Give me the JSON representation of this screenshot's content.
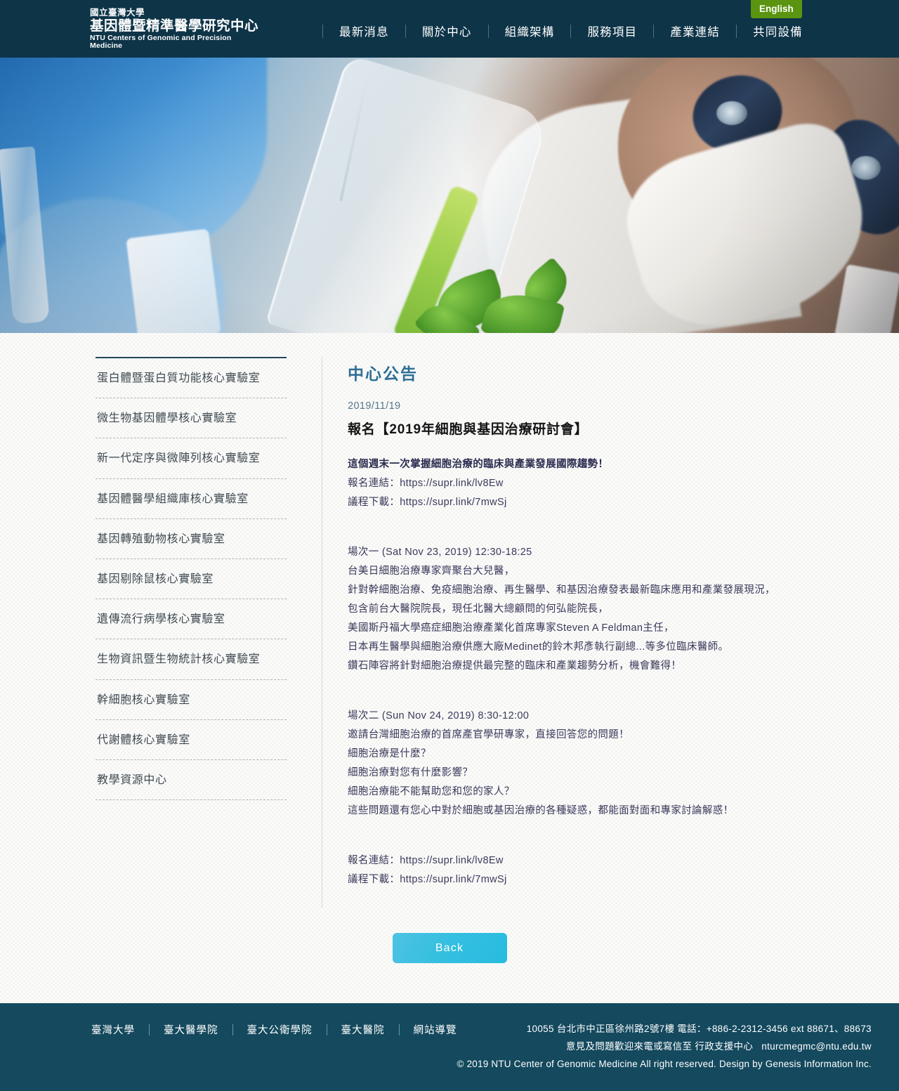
{
  "header": {
    "logo": {
      "line1": "國立臺灣大學",
      "line2": "基因體暨精準醫學研究中心",
      "line3": "NTU Centers of Genomic and Precision Medicine"
    },
    "nav": [
      {
        "label": "最新消息"
      },
      {
        "label": "關於中心"
      },
      {
        "label": "組織架構"
      },
      {
        "label": "服務項目"
      },
      {
        "label": "產業連結"
      },
      {
        "label": "共同設備"
      }
    ],
    "language_button": "English",
    "colors": {
      "header_bg": "#0e3448",
      "language_bg": "#5a9410"
    }
  },
  "sidebar": {
    "items": [
      {
        "label": "蛋白體暨蛋白質功能核心實驗室"
      },
      {
        "label": "微生物基因體學核心實驗室"
      },
      {
        "label": "新一代定序與微陣列核心實驗室"
      },
      {
        "label": "基因體醫學組織庫核心實驗室"
      },
      {
        "label": "基因轉殖動物核心實驗室"
      },
      {
        "label": "基因剔除鼠核心實驗室"
      },
      {
        "label": "遺傳流行病學核心實驗室"
      },
      {
        "label": "生物資訊暨生物統計核心實驗室"
      },
      {
        "label": "幹細胞核心實驗室"
      },
      {
        "label": "代謝體核心實驗室"
      },
      {
        "label": "教學資源中心"
      }
    ]
  },
  "article": {
    "section_title": "中心公告",
    "date": "2019/11/19",
    "title": "報名【2019年細胞與基因治療研討會】",
    "intro": [
      "這個週末一次掌握細胞治療的臨床與產業發展國際趨勢！",
      "報名連結：https://supr.link/lv8Ew",
      "議程下載：https://supr.link/7mwSj"
    ],
    "session_one": [
      "場次一 (Sat Nov 23, 2019) 12:30-18:25",
      "台美日細胞治療專家齊聚台大兒醫，",
      "針對幹細胞治療、免疫細胞治療、再生醫學、和基因治療發表最新臨床應用和產業發展現況，",
      "包含前台大醫院院長，現任北醫大總顧問的何弘能院長，",
      "美國斯丹福大學癌症細胞治療產業化首席專家Steven A Feldman主任，",
      "日本再生醫學與細胞治療供應大廠Medinet的鈴木邦彥執行副總...等多位臨床醫師。",
      "鑽石陣容將針對細胞治療提供最完整的臨床和產業趨勢分析，機會難得！"
    ],
    "session_two": [
      "場次二 (Sun Nov 24, 2019) 8:30-12:00",
      "邀請台灣細胞治療的首席產官學研專家，直接回答您的問題！",
      "細胞治療是什麼？",
      "細胞治療對您有什麼影響？",
      "細胞治療能不能幫助您和您的家人？",
      "這些問題還有您心中對於細胞或基因治療的各種疑惑，都能面對面和專家討論解惑！"
    ],
    "footer_links": [
      "報名連結：https://supr.link/lv8Ew",
      "議程下載：https://supr.link/7mwSj"
    ],
    "back_button": "Back",
    "colors": {
      "section_title": "#2f6f96",
      "date": "#55778c",
      "back_button": "#35bfe0"
    }
  },
  "footer": {
    "links": [
      {
        "label": "臺灣大學"
      },
      {
        "label": "臺大醫學院"
      },
      {
        "label": "臺大公衛學院"
      },
      {
        "label": "臺大醫院"
      },
      {
        "label": "網站導覽"
      }
    ],
    "address_line": "10055 台北市中正區徐州路2號7樓 電話：+886-2-2312-3456 ext 88671、88673",
    "contact_prefix": "意見及問題歡迎來電或寫信至 行政支援中心",
    "contact_email": "nturcmegmc@ntu.edu.tw",
    "copyright": "© 2019 NTU Center of Genomic Medicine All right reserved. Design by Genesis Information Inc.",
    "colors": {
      "footer_bg": "#14495e"
    }
  }
}
